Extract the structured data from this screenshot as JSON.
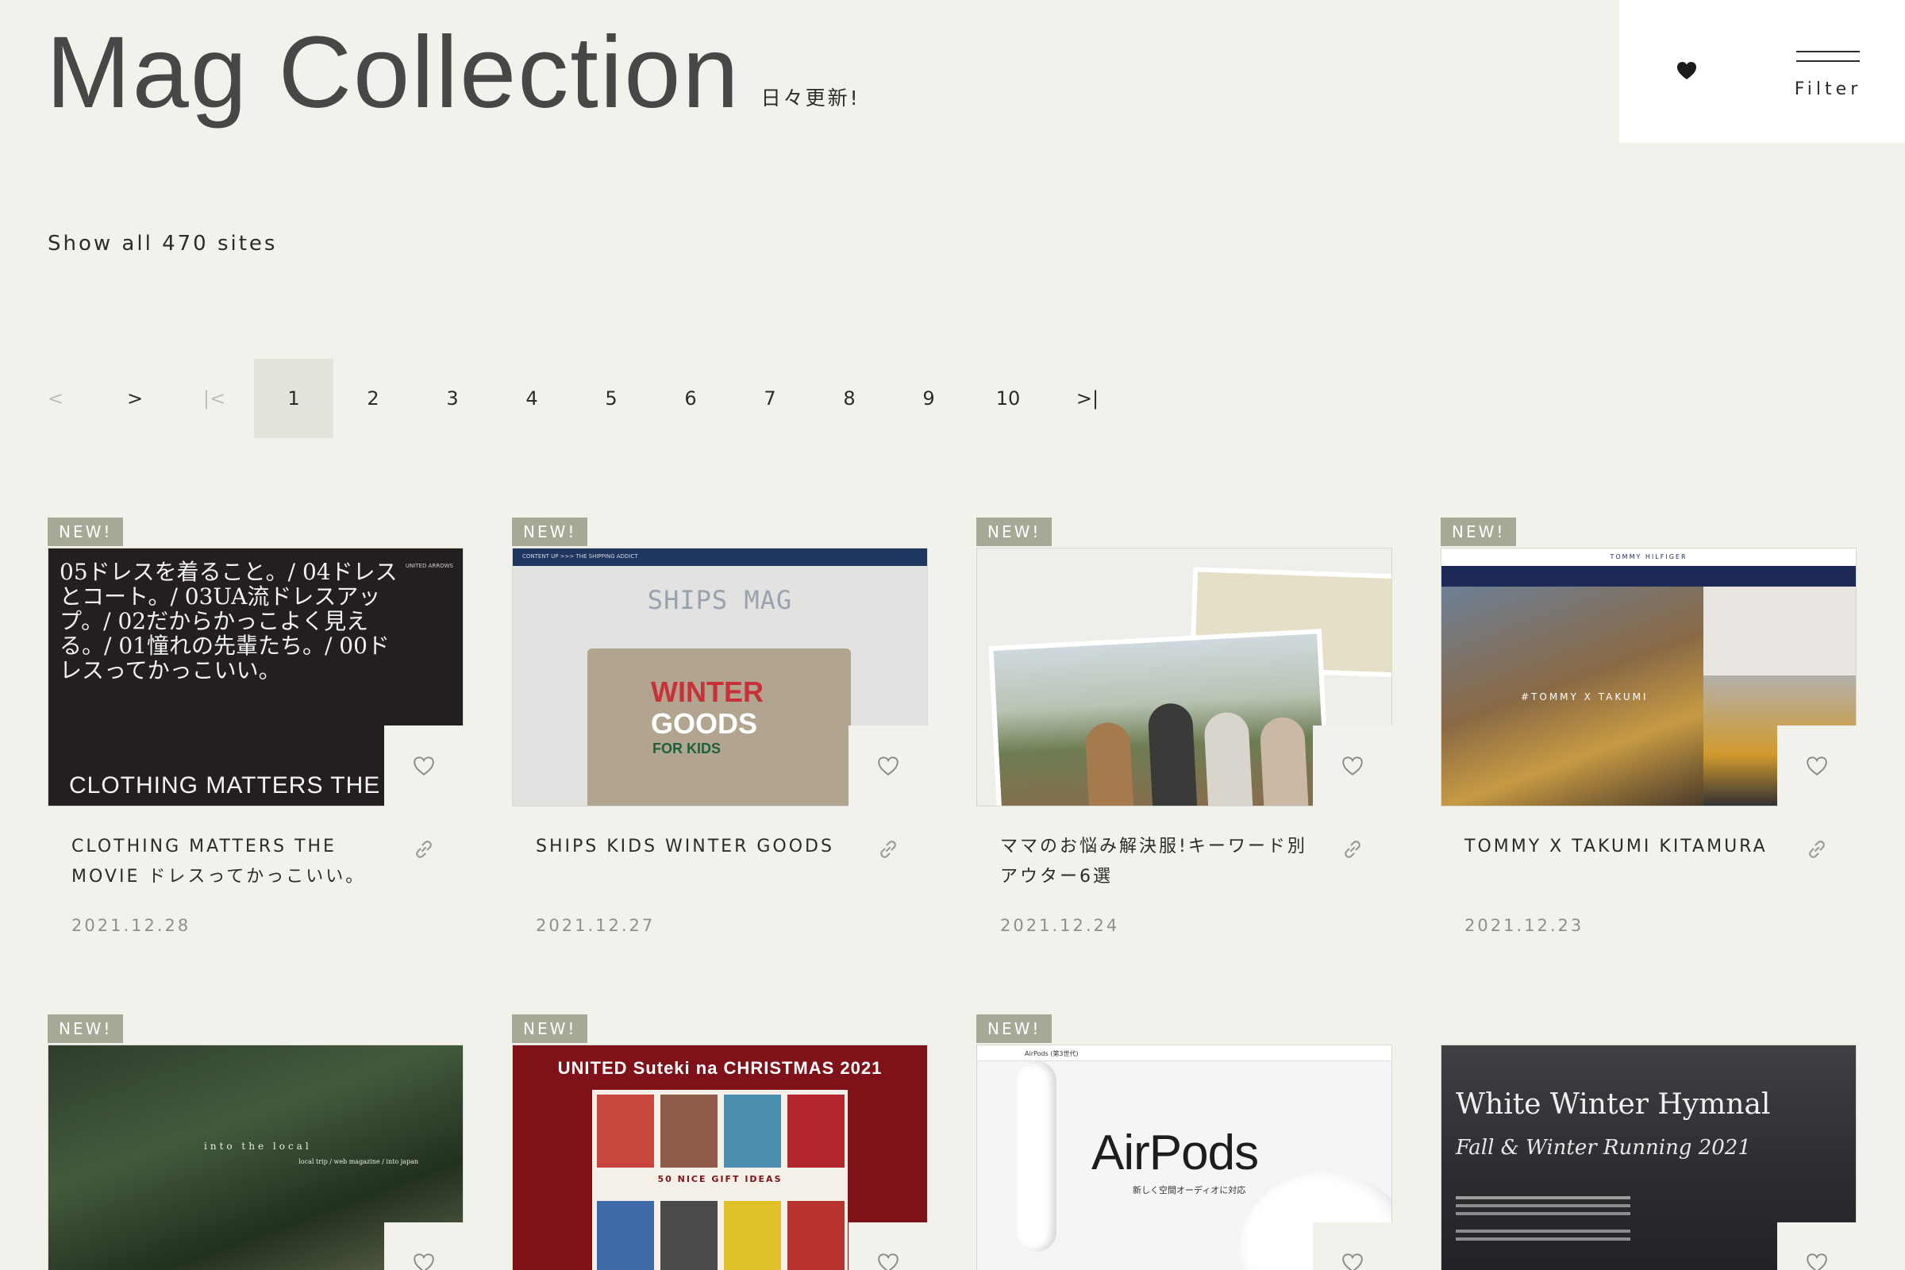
{
  "header": {
    "logo_text": "Mag Collection",
    "logo_sub": "日々更新!",
    "filter_label": "Filter",
    "favorites_icon": "heart-icon"
  },
  "show_all": "Show all 470 sites",
  "pagination": {
    "prev": "<",
    "next": ">",
    "first": "|<",
    "last": ">|",
    "pages": [
      "1",
      "2",
      "3",
      "4",
      "5",
      "6",
      "7",
      "8",
      "9",
      "10"
    ],
    "current": "1"
  },
  "cards": [
    {
      "badge": "NEW!",
      "title": "CLOTHING MATTERS THE MOVIE ドレスってかっこいい。",
      "date": "2021.12.28",
      "thumb_text": "05ドレスを着ること。/ 04ドレスとコート。/ 03UA流ドレスアップ。/ 02だからかっこよく見える。/ 01憧れの先輩たち。/ 00ドレスってかっこいい。",
      "thumb_big": "CLOTHING MATTERS THE MOVIE",
      "thumb_small": "UNITED ARROWS"
    },
    {
      "badge": "NEW!",
      "title": "SHIPS KIDS WINTER GOODS",
      "date": "2021.12.27",
      "thumb_bar": "CONTENT UP >>> THE SHIPPING ADDICT",
      "thumb_mag": "SHIPS MAG",
      "thumb_w1": "WINTER",
      "thumb_w2": "GOODS",
      "thumb_w3": "FOR KIDS"
    },
    {
      "badge": "NEW!",
      "title": "ママのお悩み解決服!キーワード別アウター6選",
      "date": "2021.12.24"
    },
    {
      "badge": "NEW!",
      "title": "TOMMY X TAKUMI KITAMURA",
      "date": "2021.12.23",
      "thumb_brand": "TOMMY HILFIGER",
      "thumb_caption": "#TOMMY X TAKUMI"
    },
    {
      "badge": "NEW!",
      "thumb_text": "into the local",
      "thumb_side": "local trip / web magazine / into japan"
    },
    {
      "badge": "NEW!",
      "thumb_head": "UNITED Suteki na CHRISTMAS 2021",
      "thumb_gift": "50 NICE GIFT IDEAS"
    },
    {
      "badge": "NEW!",
      "thumb_nav": "AirPods (第3世代)",
      "thumb_title": "AirPods",
      "thumb_sub": "新しく空間オーディオに対応"
    },
    {
      "badge": "",
      "thumb_h1": "White Winter Hymnal",
      "thumb_h2": "Fall & Winter Running 2021"
    }
  ]
}
